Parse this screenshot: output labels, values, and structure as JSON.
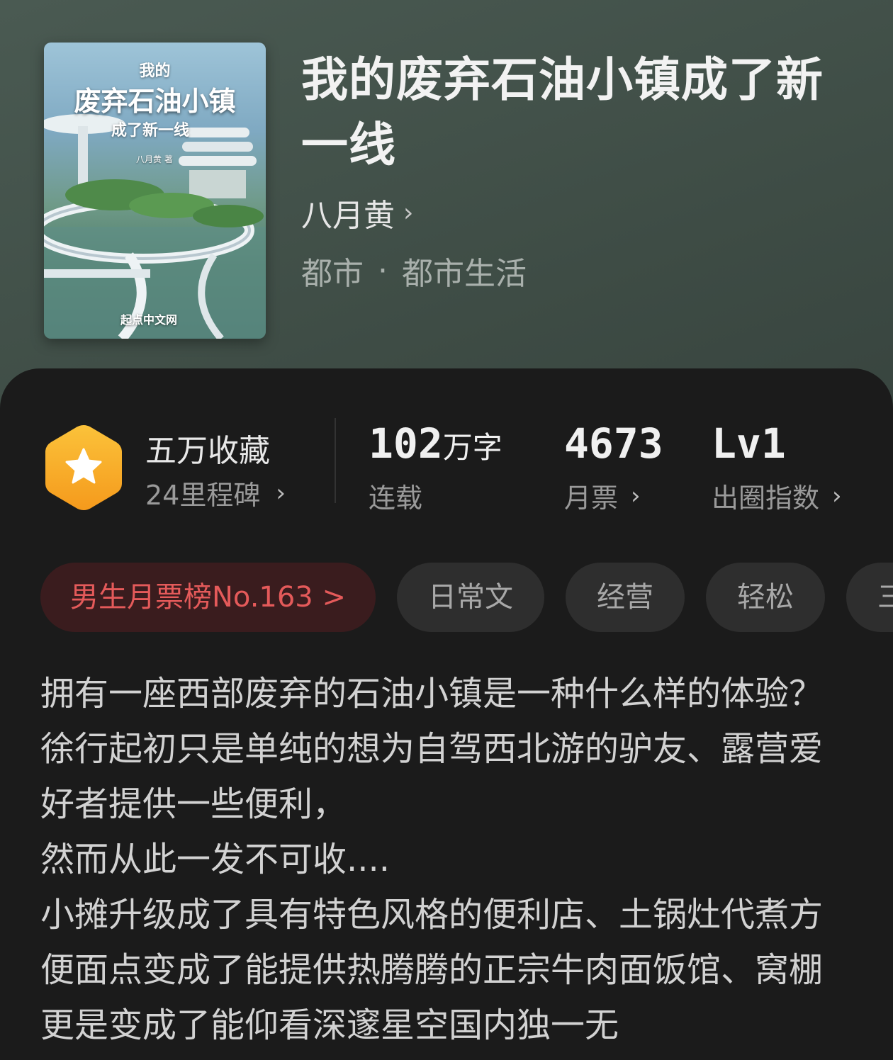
{
  "book": {
    "title": "我的废弃石油小镇成了新一线",
    "author": "八月黄",
    "author_chevron": "›",
    "genre": [
      "都市",
      "都市生活"
    ],
    "genre_separator": "·"
  },
  "cover": {
    "small_title": "我的",
    "main_title": "废弃石油小镇",
    "sub_title": "成了新一线",
    "author": "八月黄 著",
    "publisher": "起点中文网"
  },
  "stats": {
    "collection": {
      "title": "五万收藏",
      "sub": "24里程碑",
      "chevron": "›",
      "badge_icon": "star-icon"
    },
    "words": {
      "number": "102",
      "unit": "万字",
      "label": "连载"
    },
    "monthly_ticket": {
      "number": "4673",
      "label": "月票",
      "chevron": "›"
    },
    "level": {
      "number": "Lv1",
      "label": "出圈指数",
      "chevron": "›"
    }
  },
  "tags": [
    {
      "label": "男生月票榜No.163 >",
      "type": "rank"
    },
    {
      "label": "日常文",
      "type": "tag"
    },
    {
      "label": "经营",
      "type": "tag"
    },
    {
      "label": "轻松",
      "type": "tag"
    },
    {
      "label": "三",
      "type": "tag"
    }
  ],
  "description": "拥有一座西部废弃的石油小镇是一种什么样的体验？徐行起初只是单纯的想为自驾西北游的驴友、露营爱好者提供一些便利，\n然而从此一发不可收....\n小摊升级成了具有特色风格的便利店、土锅灶代煮方便面点变成了能提供热腾腾的正宗牛肉面饭馆、窝棚更是变成了能仰看深邃星空国内独一无",
  "colors": {
    "header_bg": "#3e4c45",
    "panel_bg": "#1b1b1b",
    "rank_text": "#e45a5a",
    "rank_bg": "#3a1c1e",
    "badge": "#f7b12a"
  }
}
